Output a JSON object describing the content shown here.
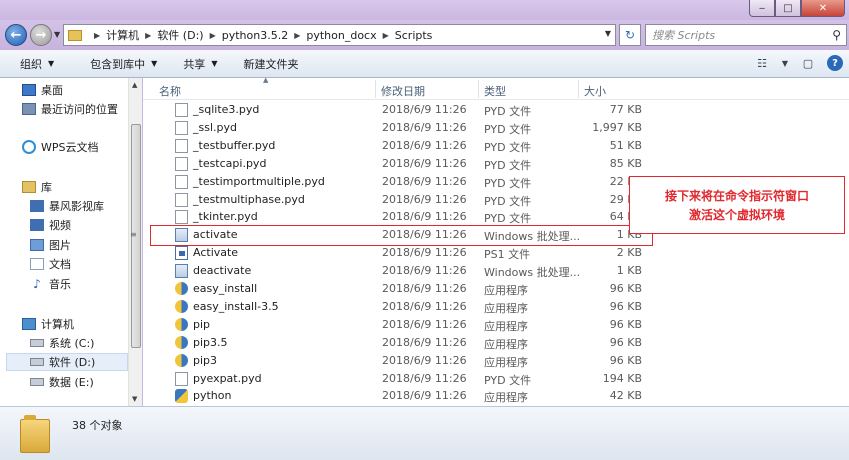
{
  "window": {
    "buttons": {
      "minimize": "‒",
      "maximize": "□",
      "close": "✕"
    }
  },
  "address": {
    "crumbs": [
      "计算机",
      "软件 (D:)",
      "python3.5.2",
      "python_docx",
      "Scripts"
    ],
    "search_placeholder": "搜索 Scripts"
  },
  "toolbar": {
    "organize": "组织",
    "include_in_library": "包含到库中",
    "share": "共享",
    "new_folder": "新建文件夹"
  },
  "nav": {
    "items": [
      {
        "label": "桌面",
        "icon": "desktop-icon"
      },
      {
        "label": "最近访问的位置",
        "icon": "recent-places-icon"
      },
      {
        "label": "WPS云文档",
        "icon": "wps-cloud-icon"
      },
      {
        "label": "库",
        "icon": "libraries-icon"
      },
      {
        "label": "暴风影视库",
        "icon": "video-library-icon"
      },
      {
        "label": "视频",
        "icon": "videos-icon"
      },
      {
        "label": "图片",
        "icon": "pictures-icon"
      },
      {
        "label": "文档",
        "icon": "documents-icon"
      },
      {
        "label": "音乐",
        "icon": "music-icon"
      },
      {
        "label": "计算机",
        "icon": "computer-icon"
      },
      {
        "label": "系统 (C:)",
        "icon": "drive-icon"
      },
      {
        "label": "软件 (D:)",
        "icon": "drive-icon"
      },
      {
        "label": "数据 (E:)",
        "icon": "drive-icon"
      }
    ]
  },
  "columns": {
    "name": "名称",
    "date": "修改日期",
    "type": "类型",
    "size": "大小"
  },
  "files": [
    {
      "name": "_sqlite3.pyd",
      "date": "2018/6/9 11:26",
      "type": "PYD 文件",
      "size": "77 KB",
      "icon": "pyd"
    },
    {
      "name": "_ssl.pyd",
      "date": "2018/6/9 11:26",
      "type": "PYD 文件",
      "size": "1,997 KB",
      "icon": "pyd"
    },
    {
      "name": "_testbuffer.pyd",
      "date": "2018/6/9 11:26",
      "type": "PYD 文件",
      "size": "51 KB",
      "icon": "pyd"
    },
    {
      "name": "_testcapi.pyd",
      "date": "2018/6/9 11:26",
      "type": "PYD 文件",
      "size": "85 KB",
      "icon": "pyd"
    },
    {
      "name": "_testimportmultiple.pyd",
      "date": "2018/6/9 11:26",
      "type": "PYD 文件",
      "size": "22 KB",
      "icon": "pyd"
    },
    {
      "name": "_testmultiphase.pyd",
      "date": "2018/6/9 11:26",
      "type": "PYD 文件",
      "size": "29 KB",
      "icon": "pyd"
    },
    {
      "name": "_tkinter.pyd",
      "date": "2018/6/9 11:26",
      "type": "PYD 文件",
      "size": "64 KB",
      "icon": "pyd"
    },
    {
      "name": "activate",
      "date": "2018/6/9 11:26",
      "type": "Windows 批处理...",
      "size": "1 KB",
      "icon": "bat"
    },
    {
      "name": "Activate",
      "date": "2018/6/9 11:26",
      "type": "PS1 文件",
      "size": "2 KB",
      "icon": "ps1"
    },
    {
      "name": "deactivate",
      "date": "2018/6/9 11:26",
      "type": "Windows 批处理...",
      "size": "1 KB",
      "icon": "bat"
    },
    {
      "name": "easy_install",
      "date": "2018/6/9 11:26",
      "type": "应用程序",
      "size": "96 KB",
      "icon": "exe"
    },
    {
      "name": "easy_install-3.5",
      "date": "2018/6/9 11:26",
      "type": "应用程序",
      "size": "96 KB",
      "icon": "exe"
    },
    {
      "name": "pip",
      "date": "2018/6/9 11:26",
      "type": "应用程序",
      "size": "96 KB",
      "icon": "exe"
    },
    {
      "name": "pip3.5",
      "date": "2018/6/9 11:26",
      "type": "应用程序",
      "size": "96 KB",
      "icon": "exe"
    },
    {
      "name": "pip3",
      "date": "2018/6/9 11:26",
      "type": "应用程序",
      "size": "96 KB",
      "icon": "exe"
    },
    {
      "name": "pyexpat.pyd",
      "date": "2018/6/9 11:26",
      "type": "PYD 文件",
      "size": "194 KB",
      "icon": "pyd"
    },
    {
      "name": "python",
      "date": "2018/6/9 11:26",
      "type": "应用程序",
      "size": "42 KB",
      "icon": "py"
    }
  ],
  "annotation": {
    "line1": "接下来将在命令指示符窗口",
    "line2": "激活这个虚拟环境"
  },
  "status": {
    "count": "38 个对象"
  }
}
